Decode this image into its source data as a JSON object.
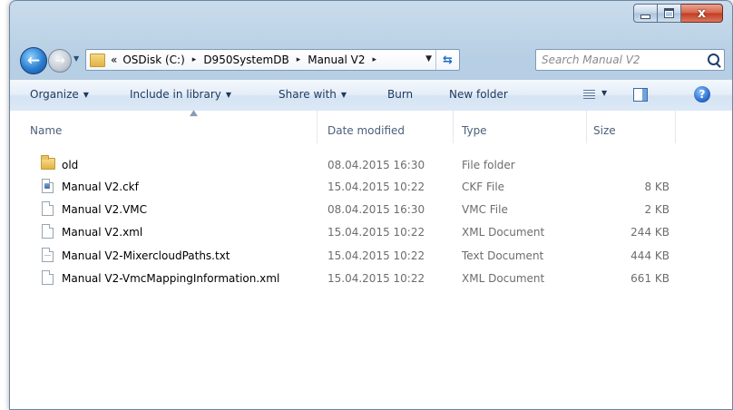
{
  "window": {
    "caption_buttons": {
      "minimize": "–",
      "maximize": "□",
      "close": "x"
    }
  },
  "address_bar": {
    "overflow": "«",
    "crumbs": [
      "OSDisk (C:)",
      "D950SystemDB",
      "Manual V2"
    ],
    "separator": "▸"
  },
  "search": {
    "placeholder": "Search Manual V2"
  },
  "toolbar": {
    "organize": "Organize",
    "include_in_library": "Include in library",
    "share_with": "Share with",
    "burn": "Burn",
    "new_folder": "New folder"
  },
  "columns": {
    "name": "Name",
    "date_modified": "Date modified",
    "type": "Type",
    "size": "Size"
  },
  "files": [
    {
      "name": "old",
      "date": "08.04.2015 16:30",
      "type": "File folder",
      "size": "",
      "icon": "folder-icon"
    },
    {
      "name": "Manual V2.ckf",
      "date": "15.04.2015 10:22",
      "type": "CKF File",
      "size": "8 KB",
      "icon": "config-file-icon"
    },
    {
      "name": "Manual V2.VMC",
      "date": "08.04.2015 16:30",
      "type": "VMC File",
      "size": "2 KB",
      "icon": "file-icon"
    },
    {
      "name": "Manual V2.xml",
      "date": "15.04.2015 10:22",
      "type": "XML Document",
      "size": "244 KB",
      "icon": "file-icon"
    },
    {
      "name": "Manual V2-MixercloudPaths.txt",
      "date": "15.04.2015 10:22",
      "type": "Text Document",
      "size": "444 KB",
      "icon": "text-file-icon"
    },
    {
      "name": "Manual V2-VmcMappingInformation.xml",
      "date": "15.04.2015 10:22",
      "type": "XML Document",
      "size": "661 KB",
      "icon": "file-icon"
    }
  ],
  "colors": {
    "frame": "#b7cfe4",
    "toolbar_text": "#1e395b",
    "secondary_text": "#6d6d6d",
    "close_button": "#c33b20"
  }
}
